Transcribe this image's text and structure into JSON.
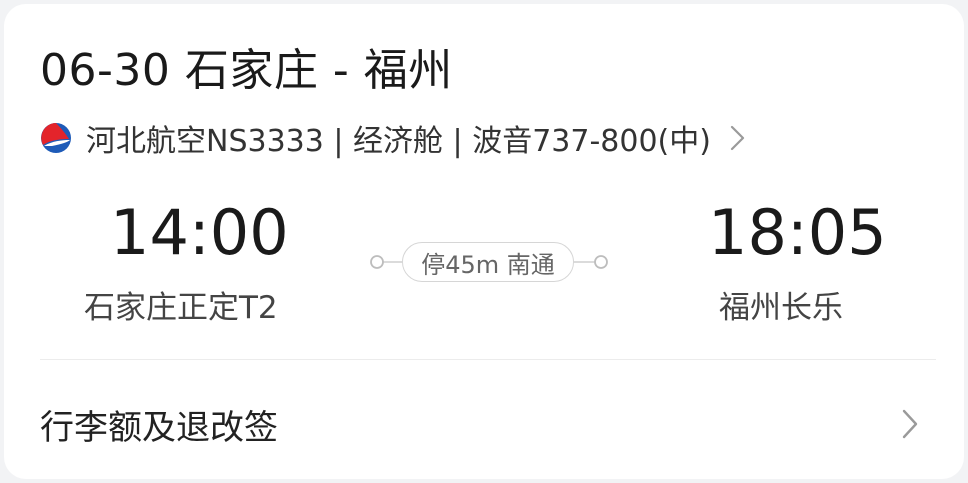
{
  "header": {
    "title": "06-30 石家庄 - 福州"
  },
  "flight": {
    "airline_logo_icon": "hebei-airlines-logo-icon",
    "info": "河北航空NS3333 | 经济舱 | 波音737-800(中)",
    "detail_icon": "chevron-right-icon"
  },
  "departure": {
    "time": "14:00",
    "airport": "石家庄正定T2"
  },
  "stopover": {
    "label": "停45m 南通"
  },
  "arrival": {
    "time": "18:05",
    "airport": "福州长乐"
  },
  "baggage": {
    "label": "行李额及退改签",
    "chevron_icon": "chevron-right-icon"
  },
  "colors": {
    "text_primary": "#1a1a1a",
    "text_secondary": "#444444",
    "logo_red": "#e3242b",
    "logo_blue": "#1e5bb8",
    "divider": "#ececec"
  }
}
